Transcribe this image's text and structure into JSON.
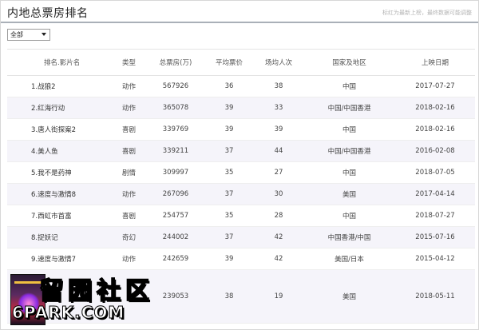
{
  "header": {
    "title": "内地总票房排名",
    "hint": "标红为最新上榜，最终数据可能调整"
  },
  "filter": {
    "selected": "全部"
  },
  "table": {
    "columns": [
      "排名.影片名",
      "类型",
      "总票房(万)",
      "平均票价",
      "场均人次",
      "国家及地区",
      "上映日期"
    ],
    "rows": [
      [
        "1.战狼2",
        "动作",
        "567926",
        "36",
        "38",
        "中国",
        "2017-07-27"
      ],
      [
        "2.红海行动",
        "动作",
        "365078",
        "39",
        "33",
        "中国/中国香港",
        "2018-02-16"
      ],
      [
        "3.唐人街探案2",
        "喜剧",
        "339769",
        "39",
        "39",
        "中国",
        "2018-02-16"
      ],
      [
        "4.美人鱼",
        "喜剧",
        "339211",
        "37",
        "44",
        "中国/中国香港",
        "2016-02-08"
      ],
      [
        "5.我不是药神",
        "剧情",
        "309997",
        "35",
        "27",
        "中国",
        "2018-07-05"
      ],
      [
        "6.速度与激情8",
        "动作",
        "267096",
        "37",
        "30",
        "美国",
        "2017-04-14"
      ],
      [
        "7.西虹市首富",
        "喜剧",
        "254757",
        "35",
        "28",
        "中国",
        "2018-07-27"
      ],
      [
        "8.捉妖记",
        "奇幻",
        "244002",
        "37",
        "42",
        "中国香港/中国",
        "2015-07-16"
      ],
      [
        "9.速度与激情7",
        "动作",
        "242659",
        "39",
        "42",
        "美国/日本",
        "2015-04-12"
      ],
      [
        "",
        "",
        "239053",
        "38",
        "19",
        "美国",
        "2018-05-11"
      ]
    ]
  },
  "watermark": {
    "cn": "留园社区",
    "en": "6PARK.COM"
  }
}
